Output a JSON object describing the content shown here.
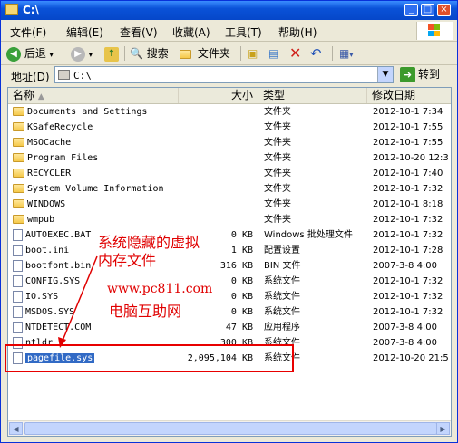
{
  "window": {
    "title": "C:\\"
  },
  "titlebar_buttons": {
    "minimize": "_",
    "maximize": "□",
    "close": "×"
  },
  "menu": [
    "文件(F)",
    "编辑(E)",
    "查看(V)",
    "收藏(A)",
    "工具(T)",
    "帮助(H)"
  ],
  "toolbar": {
    "back": "后退",
    "search": "搜索",
    "folders": "文件夹"
  },
  "address": {
    "label": "地址(D)",
    "value": "C:\\",
    "go": "转到"
  },
  "columns": {
    "name": "名称",
    "size": "大小",
    "type": "类型",
    "modified": "修改日期"
  },
  "files": [
    {
      "name": "Documents and Settings",
      "size": "",
      "type": "文件夹",
      "date": "2012-10-1 7:34",
      "kind": "folder"
    },
    {
      "name": "KSafeRecycle",
      "size": "",
      "type": "文件夹",
      "date": "2012-10-1 7:55",
      "kind": "folder"
    },
    {
      "name": "MSOCache",
      "size": "",
      "type": "文件夹",
      "date": "2012-10-1 7:55",
      "kind": "folder"
    },
    {
      "name": "Program Files",
      "size": "",
      "type": "文件夹",
      "date": "2012-10-20 12:3",
      "kind": "folder"
    },
    {
      "name": "RECYCLER",
      "size": "",
      "type": "文件夹",
      "date": "2012-10-1 7:40",
      "kind": "folder"
    },
    {
      "name": "System Volume Information",
      "size": "",
      "type": "文件夹",
      "date": "2012-10-1 7:32",
      "kind": "folder"
    },
    {
      "name": "WINDOWS",
      "size": "",
      "type": "文件夹",
      "date": "2012-10-1 8:18",
      "kind": "folder"
    },
    {
      "name": "wmpub",
      "size": "",
      "type": "文件夹",
      "date": "2012-10-1 7:32",
      "kind": "folder"
    },
    {
      "name": "AUTOEXEC.BAT",
      "size": "0 KB",
      "type": "Windows 批处理文件",
      "date": "2012-10-1 7:32",
      "kind": "file"
    },
    {
      "name": "boot.ini",
      "size": "1 KB",
      "type": "配置设置",
      "date": "2012-10-1 7:28",
      "kind": "file"
    },
    {
      "name": "bootfont.bin",
      "size": "316 KB",
      "type": "BIN 文件",
      "date": "2007-3-8 4:00",
      "kind": "file"
    },
    {
      "name": "CONFIG.SYS",
      "size": "0 KB",
      "type": "系统文件",
      "date": "2012-10-1 7:32",
      "kind": "file"
    },
    {
      "name": "IO.SYS",
      "size": "0 KB",
      "type": "系统文件",
      "date": "2012-10-1 7:32",
      "kind": "file"
    },
    {
      "name": "MSDOS.SYS",
      "size": "0 KB",
      "type": "系统文件",
      "date": "2012-10-1 7:32",
      "kind": "file"
    },
    {
      "name": "NTDETECT.COM",
      "size": "47 KB",
      "type": "应用程序",
      "date": "2007-3-8 4:00",
      "kind": "file"
    },
    {
      "name": "ntldr",
      "size": "300 KB",
      "type": "系统文件",
      "date": "2007-3-8 4:00",
      "kind": "file"
    },
    {
      "name": "pagefile.sys",
      "size": "2,095,104 KB",
      "type": "系统文件",
      "date": "2012-10-20 21:5",
      "kind": "file",
      "selected": true
    }
  ],
  "annotation": {
    "line1": "系统隐藏的虚拟",
    "line2": "内存文件",
    "url": "www.pc811.com",
    "site": "电脑互助网",
    "color": "#e00000"
  }
}
